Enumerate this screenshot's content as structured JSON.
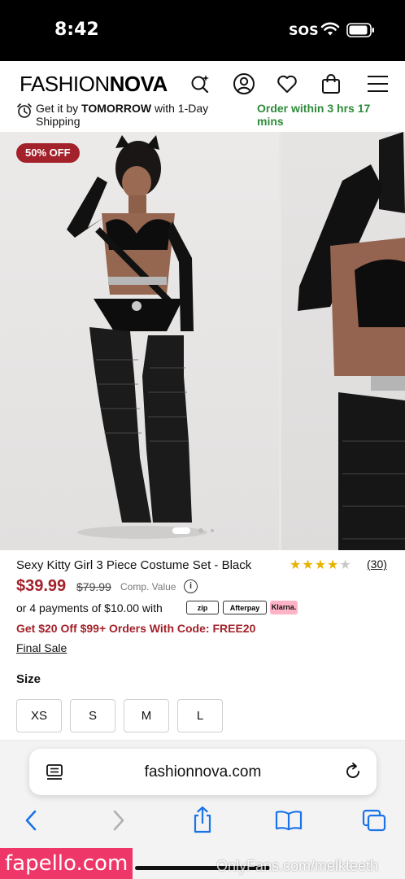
{
  "status_bar": {
    "time": "8:42",
    "sos": "SOS"
  },
  "header": {
    "logo_part1": "FASHION",
    "logo_part2": "NOVA",
    "icons": [
      "search-sparkle-icon",
      "account-icon",
      "wishlist-heart-icon",
      "cart-bag-icon",
      "menu-icon"
    ]
  },
  "shipping_banner": {
    "prefix": "Get it by ",
    "highlight": "TOMORROW",
    "suffix": " with 1-Day Shipping",
    "order_within": "Order within 3 hrs 17 mins"
  },
  "gallery": {
    "badge": "50% OFF",
    "slide_count": 3,
    "active_slide": 1
  },
  "product": {
    "title": "Sexy Kitty Girl 3 Piece Costume Set - Black",
    "rating": 4,
    "rating_max": 5,
    "review_count": "(30)",
    "price": "$39.99",
    "compare_price": "$79.99",
    "comp_label": "Comp. Value",
    "installments_text": "or 4 payments of $10.00 with",
    "payment_providers": [
      "zip",
      "Afterpay",
      "Klarna."
    ],
    "promo": "Get $20 Off $99+ Orders With Code: FREE20",
    "final_sale": "Final Sale"
  },
  "size": {
    "label": "Size",
    "options": [
      "XS",
      "S",
      "M",
      "L"
    ]
  },
  "browser": {
    "url": "fashionnova.com"
  },
  "watermarks": {
    "left": "fapello.com",
    "right": "OnlyFans.com/melkteeth"
  },
  "colors": {
    "sale_red": "#a3212a",
    "order_green": "#2e8b3a",
    "star_gold": "#e8b300",
    "watermark_pink": "#ee3768"
  }
}
